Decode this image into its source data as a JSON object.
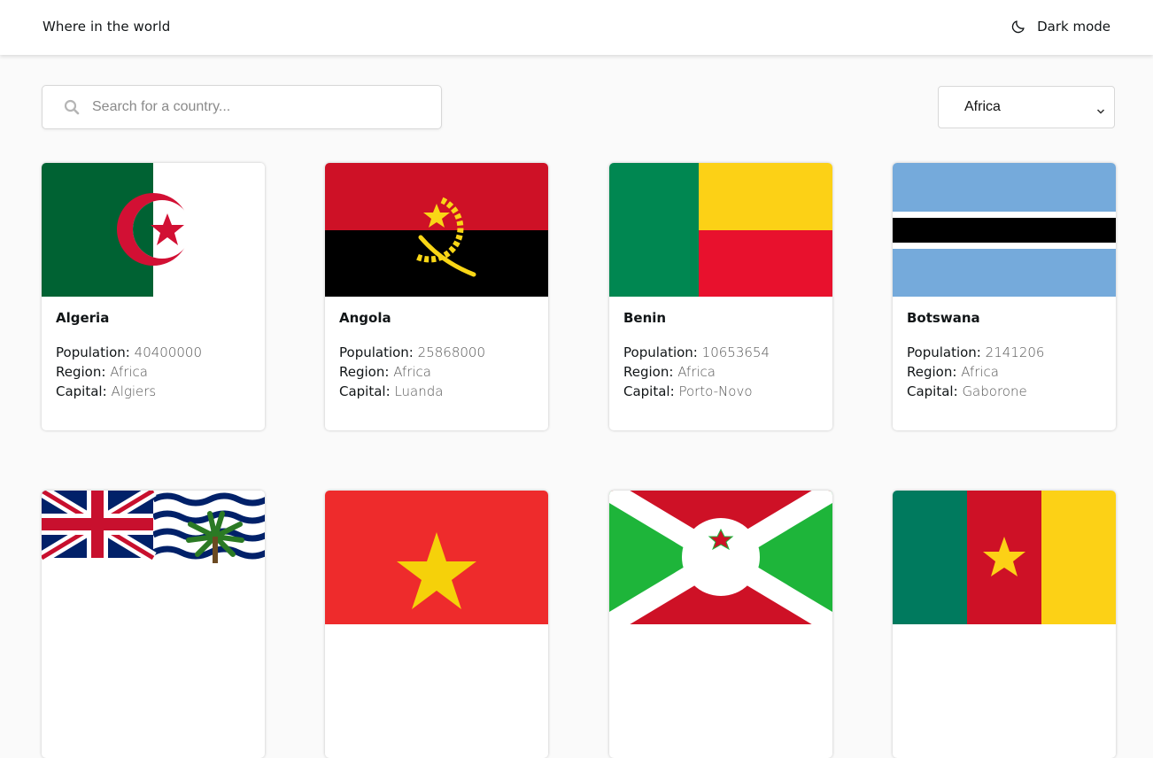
{
  "header": {
    "app_title": "Where in the world",
    "dark_mode_label": "Dark mode"
  },
  "search": {
    "placeholder": "Search for a country...",
    "value": ""
  },
  "filter": {
    "selected": "Africa"
  },
  "labels": {
    "population": "Population:",
    "region": "Region:",
    "capital": "Capital:"
  },
  "countries": [
    {
      "name": "Algeria",
      "population": "40400000",
      "region": "Africa",
      "capital": "Algiers"
    },
    {
      "name": "Angola",
      "population": "25868000",
      "region": "Africa",
      "capital": "Luanda"
    },
    {
      "name": "Benin",
      "population": "10653654",
      "region": "Africa",
      "capital": "Porto-Novo"
    },
    {
      "name": "Botswana",
      "population": "2141206",
      "region": "Africa",
      "capital": "Gaborone"
    }
  ],
  "colors": {
    "background": "#fafafa",
    "card": "#ffffff",
    "text": "#111517"
  }
}
